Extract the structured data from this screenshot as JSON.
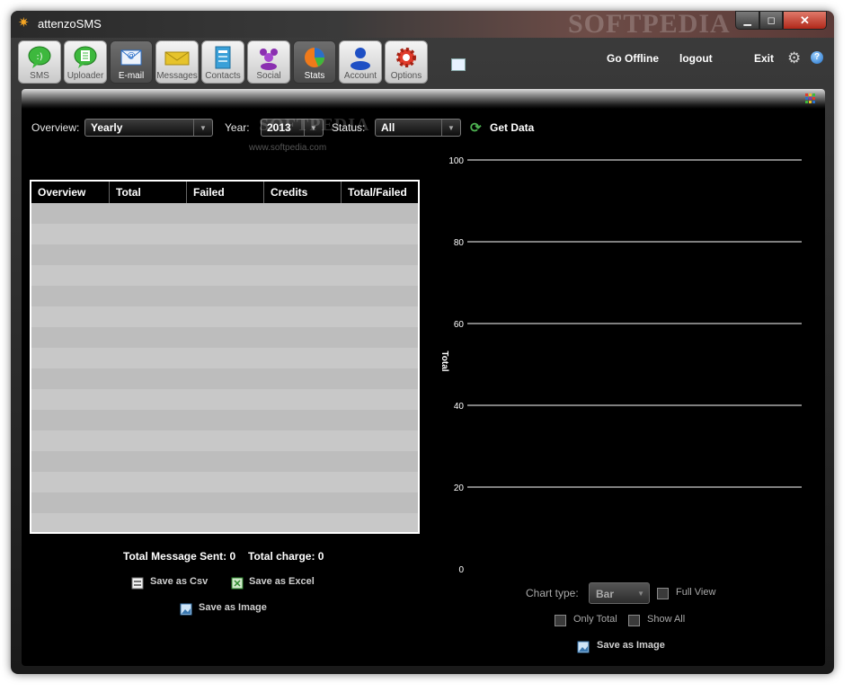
{
  "window": {
    "title": "attenzoSMS",
    "watermark": "SOFTPEDIA",
    "controls": {
      "minimize": "▁",
      "maximize": "◻",
      "close": "✕"
    }
  },
  "toolbar": {
    "items": [
      {
        "label": "SMS",
        "icon": "sms-bubble-icon",
        "color": "#3db83d"
      },
      {
        "label": "Uploader",
        "icon": "uploader-bubble-icon",
        "color": "#3db83d"
      },
      {
        "label": "E-mail",
        "icon": "email-envelope-icon",
        "color": "#2a6fc9",
        "active": true
      },
      {
        "label": "Messages",
        "icon": "messages-icon",
        "color": "#e6c32b"
      },
      {
        "label": "Contacts",
        "icon": "contacts-book-icon",
        "color": "#3aa0d8"
      },
      {
        "label": "Social",
        "icon": "social-people-icon",
        "color": "#8a2fb0"
      },
      {
        "label": "Stats",
        "icon": "stats-pie-icon",
        "color": "#f07a1a",
        "active": true
      },
      {
        "label": "Account",
        "icon": "account-user-icon",
        "color": "#1e4fc4"
      },
      {
        "label": "Options",
        "icon": "options-gear-icon",
        "color": "#e03a2a"
      }
    ],
    "links": {
      "go_offline": "Go Offline",
      "logout": "logout",
      "exit": "Exit"
    },
    "help": "?"
  },
  "filters": {
    "overview_label": "Overview:",
    "overview_value": "Yearly",
    "year_label": "Year:",
    "year_value": "2013",
    "status_label": "Status:",
    "status_value": "All",
    "get_data": "Get Data",
    "watermark_text": "SOFTPEDIA",
    "watermark_url": "www.softpedia.com"
  },
  "table": {
    "columns": [
      "Overview",
      "Total",
      "Failed",
      "Credits",
      "Total/Failed"
    ],
    "rows": []
  },
  "summary": {
    "sent": "Total Message Sent: 0",
    "charge": "Total charge: 0"
  },
  "actions": {
    "save_csv": "Save as Csv",
    "save_excel": "Save as Excel",
    "save_image": "Save as Image"
  },
  "chart_data": {
    "type": "bar",
    "categories": [],
    "series": [],
    "ylabel": "Total",
    "ylim": [
      0,
      100
    ],
    "yticks": [
      0,
      20,
      40,
      60,
      80,
      100
    ],
    "grid": true
  },
  "chart_controls": {
    "chart_type_label": "Chart type:",
    "chart_type_value": "Bar",
    "full_view": "Full View",
    "only_total": "Only Total",
    "show_all": "Show All",
    "save_image": "Save as Image"
  },
  "colors": {
    "panel_bg": "#000000",
    "grid_line": "#ffffff",
    "table_row_a": "#bdbdbd",
    "table_row_b": "#c8c8c8"
  }
}
